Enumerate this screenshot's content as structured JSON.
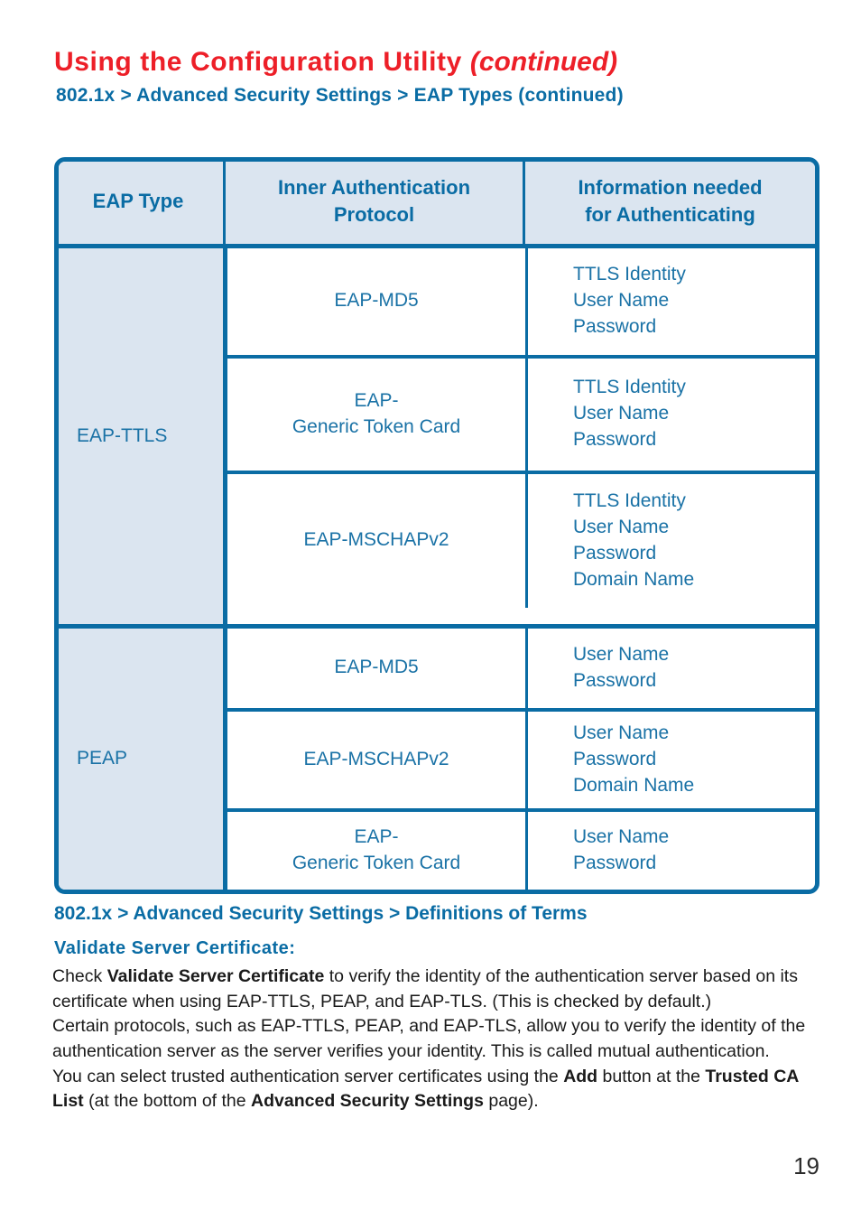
{
  "header": {
    "title_main": "Using  the  Configuration  Utility ",
    "title_continued": "(continued)",
    "breadcrumb": "802.1x > Advanced Security Settings > EAP Types (continued)"
  },
  "table": {
    "columns": [
      "EAP  Type",
      "Inner Authentication",
      "Protocol",
      "Information needed",
      "for Authenticating"
    ],
    "col1_header": "EAP  Type",
    "col2_header_line1": "Inner Authentication",
    "col2_header_line2": "Protocol",
    "col3_header_line1": "Information needed",
    "col3_header_line2": "for Authenticating",
    "groups": [
      {
        "eap_type": "EAP-TTLS",
        "rows": [
          {
            "protocol_line1": "EAP-MD5",
            "protocol_line2": "",
            "info": [
              "TTLS Identity",
              "User Name",
              "Password"
            ]
          },
          {
            "protocol_line1": "EAP-",
            "protocol_line2": "Generic Token Card",
            "info": [
              "TTLS Identity",
              "User Name",
              "Password"
            ]
          },
          {
            "protocol_line1": "EAP-MSCHAPv2",
            "protocol_line2": "",
            "info": [
              "TTLS Identity",
              "User Name",
              "Password",
              "Domain Name"
            ]
          }
        ]
      },
      {
        "eap_type": "PEAP",
        "rows": [
          {
            "protocol_line1": "EAP-MD5",
            "protocol_line2": "",
            "info": [
              "User Name",
              "Password"
            ]
          },
          {
            "protocol_line1": "EAP-MSCHAPv2",
            "protocol_line2": "",
            "info": [
              "User Name",
              "Password",
              "Domain Name"
            ]
          },
          {
            "protocol_line1": "EAP-",
            "protocol_line2": "Generic Token Card",
            "info": [
              "User Name",
              "Password"
            ]
          }
        ]
      }
    ]
  },
  "definitions": {
    "section_heading": "802.1x > Advanced Security Settings > Definitions of Terms",
    "term_heading": "Validate  Server  Certificate:",
    "para1_a": "Check ",
    "para1_bold": "Validate Server Certificate",
    "para1_b": " to verify the identity of the authentication server based on its certificate when using EAP-TTLS, PEAP, and EAP-TLS. (This is checked by default.)",
    "para2": "Certain protocols, such as EAP-TTLS, PEAP, and EAP-TLS, allow you to verify the identity of the authentication server as the server verifies your identity. This is called mutual authentication.",
    "para3_a": "You can select trusted authentication server certificates using the ",
    "para3_bold1": "Add",
    "para3_b": " button at the ",
    "para3_bold2": "Trusted CA List",
    "para3_c": " (at the bottom of the ",
    "para3_bold3": "Advanced Security Settings",
    "para3_d": " page)."
  },
  "page_number": "19",
  "colors": {
    "title_red": "#ed1f28",
    "heading_blue": "#0a6ca4",
    "text_blue": "#1a72a6",
    "cell_fill": "#dbe5f0",
    "body_text": "#1a1a1a"
  }
}
